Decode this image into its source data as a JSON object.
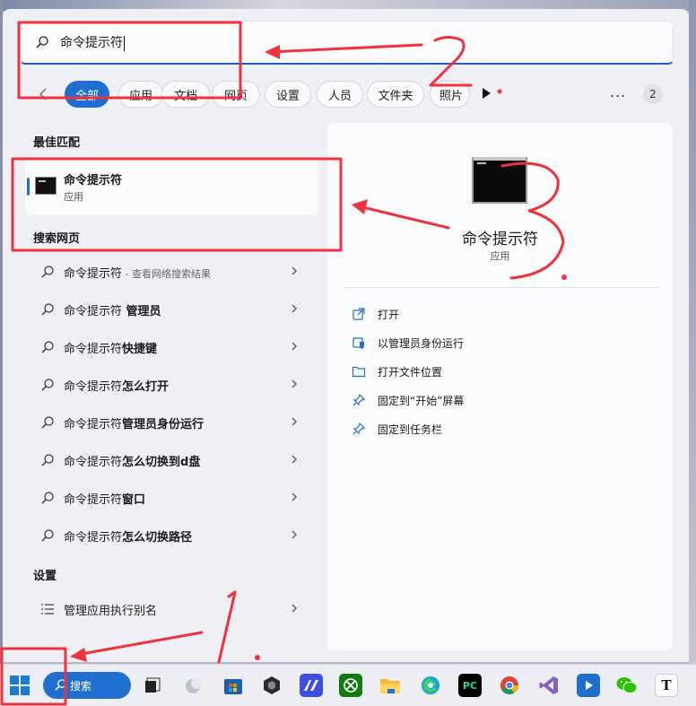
{
  "search": {
    "query": "命令提示符"
  },
  "tabs": {
    "items": [
      {
        "label": "全部",
        "active": true
      },
      {
        "label": "应用"
      },
      {
        "label": "文档"
      },
      {
        "label": "网页"
      },
      {
        "label": "设置"
      },
      {
        "label": "人员"
      },
      {
        "label": "文件夹"
      },
      {
        "label": "照片"
      }
    ],
    "more": "...",
    "badge_count": "2"
  },
  "sections": {
    "best_match": "最佳匹配",
    "web_search": "搜索网页",
    "settings": "设置"
  },
  "best_match": {
    "name": "命令提示符",
    "type": "应用",
    "icon": "cmd-icon"
  },
  "web_results": [
    {
      "text": "命令提示符",
      "sub": " - 查看网络搜索结果"
    },
    {
      "text": "命令提示符",
      "bold": " 管理员"
    },
    {
      "text": "命令提示符",
      "bold": "快捷键"
    },
    {
      "text": "命令提示符",
      "bold": "怎么打开"
    },
    {
      "text": "命令提示符",
      "bold": "管理员身份运行"
    },
    {
      "text": "命令提示符",
      "bold": "怎么切换到d盘"
    },
    {
      "text": "命令提示符",
      "bold": "窗口"
    },
    {
      "text": "命令提示符",
      "bold": "怎么切换路径"
    }
  ],
  "settings_results": [
    {
      "text": "管理应用执行别名",
      "icon": "list-icon"
    }
  ],
  "detail": {
    "name": "命令提示符",
    "type": "应用",
    "actions": [
      {
        "label": "打开",
        "icon": "open-icon"
      },
      {
        "label": "以管理员身份运行",
        "icon": "shield-icon"
      },
      {
        "label": "打开文件位置",
        "icon": "folder-icon"
      },
      {
        "label": "固定到“开始”屏幕",
        "icon": "pin-icon"
      },
      {
        "label": "固定到任务栏",
        "icon": "pin-icon"
      }
    ]
  },
  "taskbar": {
    "search_label": "搜索",
    "icons": [
      "windows-start-icon",
      "search-icon",
      "task-view-icon",
      "widgets-icon",
      "store-icon",
      "unity-icon",
      "app-m-icon",
      "xbox-icon",
      "file-explorer-icon",
      "edge-icon",
      "pycharm-icon",
      "chrome-icon",
      "visual-studio-icon",
      "media-player-icon",
      "wechat-icon",
      "typora-icon"
    ],
    "pycharm_label": "PC",
    "typora_label": "T"
  },
  "annotations": {
    "marks": [
      "1.",
      "2",
      "3."
    ],
    "color": "#f0323c"
  },
  "colors": {
    "accent": "#1f6fd0",
    "annotation": "#f0323c"
  }
}
